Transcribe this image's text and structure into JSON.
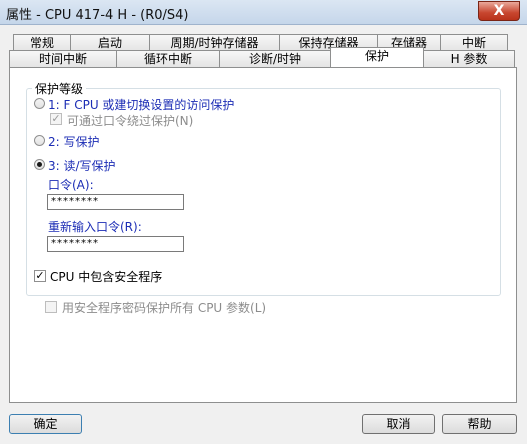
{
  "window": {
    "title": "属性 - CPU 417-4 H - (R0/S4)",
    "close_label": "X"
  },
  "tabs_row1": [
    {
      "label": "常规"
    },
    {
      "label": "启动"
    },
    {
      "label": "周期/时钟存储器"
    },
    {
      "label": "保持存储器"
    },
    {
      "label": "存储器"
    },
    {
      "label": "中断"
    }
  ],
  "tabs_row2": [
    {
      "label": "时间中断"
    },
    {
      "label": "循环中断"
    },
    {
      "label": "诊断/时钟"
    },
    {
      "label": "保护"
    },
    {
      "label": "H 参数"
    }
  ],
  "active_tab": "保护",
  "protection": {
    "group_label": "保护等级",
    "level1_label": "1: F CPU 或建切换设置的访问保护",
    "level1_sub_label": "可通过口令绕过保护(N)",
    "level2_label": "2: 写保护",
    "level3_label": "3: 读/写保护",
    "selected_level": 3,
    "password_label": "口令(A):",
    "password_value": "********",
    "reenter_label": "重新输入口令(R):",
    "reenter_value": "********"
  },
  "safety": {
    "cpu_safety_label": "CPU 中包含安全程序",
    "cpu_safety_checked": true,
    "protect_all_label": "用安全程序密码保护所有 CPU 参数(L)",
    "protect_all_checked": false
  },
  "buttons": {
    "ok": "确定",
    "cancel": "取消",
    "help": "帮助"
  }
}
